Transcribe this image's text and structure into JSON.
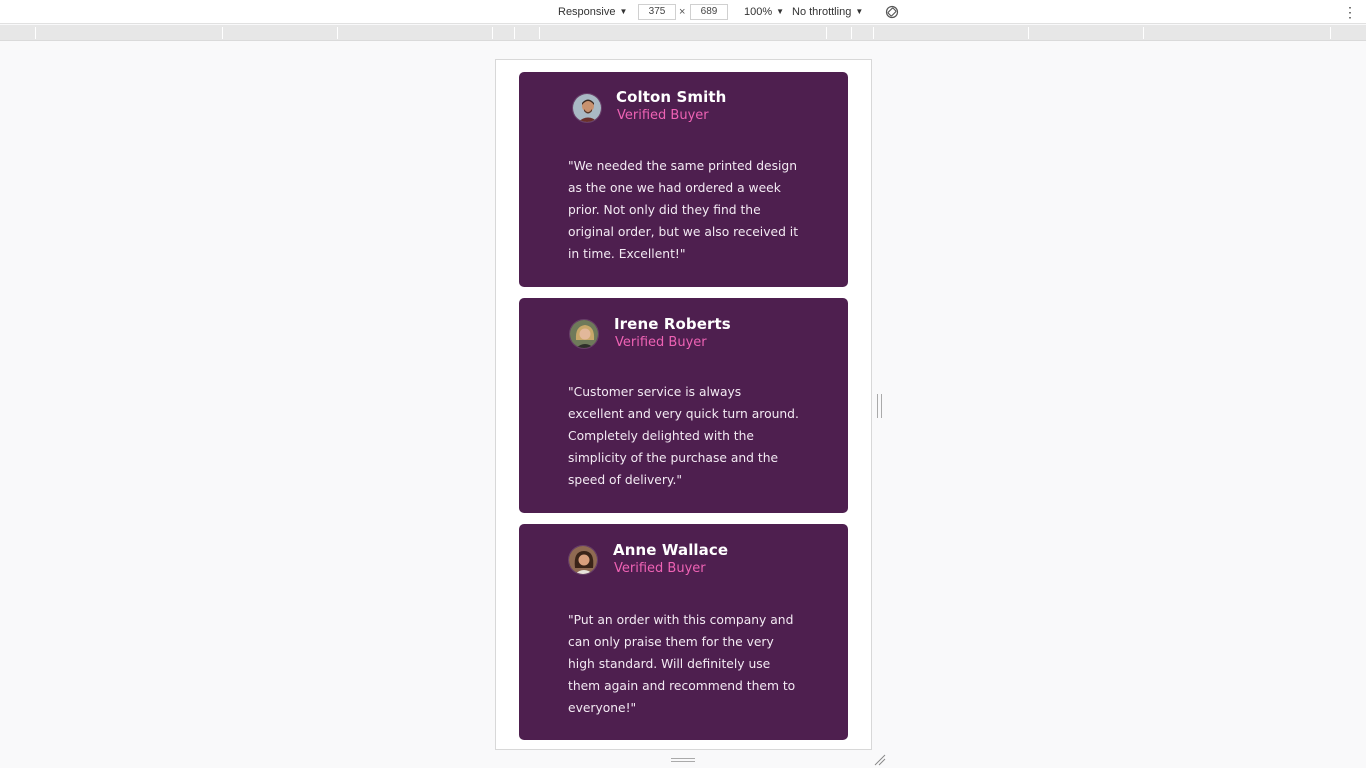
{
  "toolbar": {
    "device": "Responsive",
    "width": "375",
    "height": "689",
    "times": "×",
    "zoom": "100%",
    "throttling": "No throttling",
    "more": "⋮"
  },
  "testimonials": [
    {
      "name": "Colton Smith",
      "role": "Verified Buyer",
      "quote": "\"We needed the same printed design as the one we had ordered a week prior. Not only did they find the original order, but we also received it in time. Excellent!\""
    },
    {
      "name": "Irene Roberts",
      "role": "Verified Buyer",
      "quote": "\"Customer service is always excellent and very quick turn around. Completely delighted with the simplicity of the purchase and the speed of delivery.\""
    },
    {
      "name": "Anne Wallace",
      "role": "Verified Buyer",
      "quote": "\"Put an order with this company and can only praise them for the very high standard. Will definitely use them again and recommend them to everyone!\""
    }
  ],
  "colors": {
    "card_bg": "#4e1f4f",
    "accent_pink": "#ee62b4",
    "page_bg": "#f9f9fa"
  }
}
